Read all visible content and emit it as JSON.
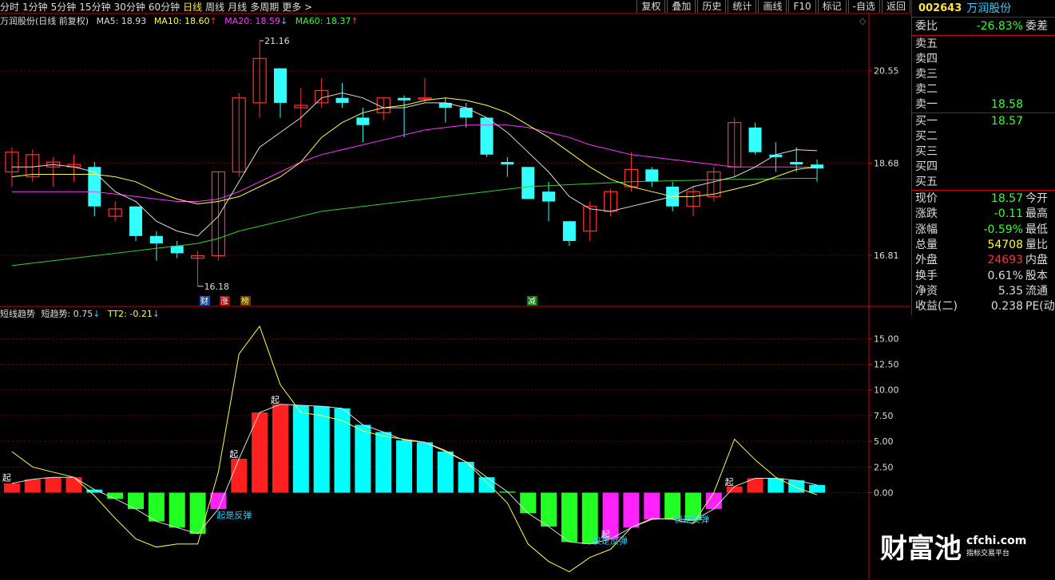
{
  "toolbar": {
    "timeframes": [
      "分时",
      "1分钟",
      "5分钟",
      "15分钟",
      "30分钟",
      "60分钟",
      "日线",
      "周线",
      "月线",
      "多周期",
      "更多 >"
    ],
    "active": "日线",
    "tools": [
      "复权",
      "叠加",
      "历史",
      "统计",
      "画线",
      "F10",
      "标记",
      "-自选",
      "返回"
    ]
  },
  "ma_header": {
    "title": "万润股份(日线 前复权)",
    "ma5": "MA5: 18.93",
    "ma5_color": "#dddddd",
    "ma10": "MA10: 18.60",
    "ma10_color": "#ffff44",
    "ma20": "MA20: 18.59",
    "ma20_color": "#ff33ff",
    "ma60": "MA60: 18.37",
    "ma60_color": "#33ff33"
  },
  "indicator_header": {
    "title": "短线趋势",
    "v1": "短趋势: 0.75",
    "v2": "TT2: -0.21"
  },
  "price_axis_labels": [
    "20.55",
    "18.68",
    "16.81"
  ],
  "ind_axis_labels": [
    "15.00",
    "12.50",
    "10.00",
    "7.50",
    "5.00",
    "2.50",
    "0.00"
  ],
  "annotations": {
    "high": "21.16",
    "low": "16.18",
    "tag1": "财",
    "tag2": "涨",
    "tag3": "榜",
    "tag4": "减",
    "qi": "起",
    "rebound1": "起是反弹",
    "rebound2": "仅是反弹",
    "rebound3": "仅是反弹"
  },
  "side_panel": {
    "code": "002643",
    "name": "万润股份",
    "weibi_label": "委比",
    "weibi_val": "-26.83%",
    "weicha_label": "委差",
    "asks": [
      {
        "label": "卖五",
        "val": ""
      },
      {
        "label": "卖四",
        "val": ""
      },
      {
        "label": "卖三",
        "val": ""
      },
      {
        "label": "卖二",
        "val": ""
      },
      {
        "label": "卖一",
        "val": "18.58"
      }
    ],
    "bids": [
      {
        "label": "买一",
        "val": "18.57"
      },
      {
        "label": "买二",
        "val": ""
      },
      {
        "label": "买三",
        "val": ""
      },
      {
        "label": "买四",
        "val": ""
      },
      {
        "label": "买五",
        "val": ""
      }
    ],
    "stats": [
      {
        "label": "现价",
        "val": "18.57",
        "label2": "今开",
        "color": "#33ff33"
      },
      {
        "label": "涨跌",
        "val": "-0.11",
        "label2": "最高",
        "color": "#33ff33"
      },
      {
        "label": "涨幅",
        "val": "-0.59%",
        "label2": "最低",
        "color": "#33ff33"
      },
      {
        "label": "总量",
        "val": "54708",
        "label2": "量比",
        "color": "#ffff33"
      },
      {
        "label": "外盘",
        "val": "24693",
        "label2": "内盘",
        "color": "#ff3333"
      },
      {
        "label": "换手",
        "val": "0.61%",
        "label2": "股本",
        "color": "#dddddd"
      },
      {
        "label": "净资",
        "val": "5.35",
        "label2": "流通",
        "color": "#dddddd"
      },
      {
        "label": "收益(二)",
        "val": "0.238",
        "label2": "PE(动)",
        "color": "#dddddd"
      }
    ]
  },
  "logo": {
    "big": "财富池",
    "site": "cfchi.com",
    "sub": "指标交易平台"
  },
  "chart_data": [
    {
      "type": "candlestick",
      "title": "万润股份(日线 前复权)",
      "ylim": [
        16.0,
        21.5
      ],
      "yticks": [
        20.55,
        18.68,
        16.81
      ],
      "candles": [
        {
          "o": 18.5,
          "c": 18.9,
          "h": 19.0,
          "l": 18.2
        },
        {
          "o": 18.4,
          "c": 18.85,
          "h": 18.95,
          "l": 18.3
        },
        {
          "o": 18.6,
          "c": 18.7,
          "h": 18.8,
          "l": 18.2
        },
        {
          "o": 18.6,
          "c": 18.65,
          "h": 18.85,
          "l": 18.3
        },
        {
          "o": 18.6,
          "c": 17.8,
          "h": 18.7,
          "l": 17.6
        },
        {
          "o": 17.6,
          "c": 17.75,
          "h": 17.9,
          "l": 17.5
        },
        {
          "o": 17.8,
          "c": 17.2,
          "h": 17.8,
          "l": 17.1
        },
        {
          "o": 17.2,
          "c": 17.05,
          "h": 17.3,
          "l": 16.7
        },
        {
          "o": 17.0,
          "c": 16.85,
          "h": 17.1,
          "l": 16.75
        },
        {
          "o": 16.75,
          "c": 16.8,
          "h": 16.9,
          "l": 16.18
        },
        {
          "o": 16.8,
          "c": 18.5,
          "h": 18.5,
          "l": 16.7
        },
        {
          "o": 18.5,
          "c": 20.0,
          "h": 20.1,
          "l": 18.4
        },
        {
          "o": 19.9,
          "c": 20.8,
          "h": 21.16,
          "l": 19.6
        },
        {
          "o": 20.6,
          "c": 19.9,
          "h": 20.6,
          "l": 19.6
        },
        {
          "o": 19.8,
          "c": 19.85,
          "h": 20.2,
          "l": 19.4
        },
        {
          "o": 19.9,
          "c": 20.15,
          "h": 20.4,
          "l": 19.8
        },
        {
          "o": 20.0,
          "c": 19.9,
          "h": 20.3,
          "l": 19.8
        },
        {
          "o": 19.6,
          "c": 19.45,
          "h": 19.8,
          "l": 19.1
        },
        {
          "o": 19.7,
          "c": 20.0,
          "h": 20.0,
          "l": 19.55
        },
        {
          "o": 20.0,
          "c": 19.95,
          "h": 20.05,
          "l": 19.2
        },
        {
          "o": 20.0,
          "c": 20.0,
          "h": 20.4,
          "l": 19.9
        },
        {
          "o": 19.9,
          "c": 19.8,
          "h": 20.0,
          "l": 19.5
        },
        {
          "o": 19.8,
          "c": 19.6,
          "h": 19.9,
          "l": 19.4
        },
        {
          "o": 19.6,
          "c": 18.85,
          "h": 19.6,
          "l": 18.8
        },
        {
          "o": 18.7,
          "c": 18.65,
          "h": 18.8,
          "l": 18.4
        },
        {
          "o": 18.6,
          "c": 17.95,
          "h": 18.6,
          "l": 17.95
        },
        {
          "o": 18.1,
          "c": 17.9,
          "h": 18.3,
          "l": 17.5
        },
        {
          "o": 17.5,
          "c": 17.1,
          "h": 17.5,
          "l": 17.0
        },
        {
          "o": 17.3,
          "c": 17.8,
          "h": 17.9,
          "l": 17.1
        },
        {
          "o": 17.7,
          "c": 18.1,
          "h": 18.15,
          "l": 17.6
        },
        {
          "o": 18.2,
          "c": 18.55,
          "h": 18.9,
          "l": 18.1
        },
        {
          "o": 18.55,
          "c": 18.3,
          "h": 18.6,
          "l": 18.2
        },
        {
          "o": 18.2,
          "c": 17.8,
          "h": 18.3,
          "l": 17.7
        },
        {
          "o": 17.8,
          "c": 18.1,
          "h": 18.2,
          "l": 17.6
        },
        {
          "o": 18.0,
          "c": 18.5,
          "h": 18.6,
          "l": 17.9
        },
        {
          "o": 18.6,
          "c": 19.5,
          "h": 19.6,
          "l": 18.4
        },
        {
          "o": 19.4,
          "c": 18.9,
          "h": 19.5,
          "l": 18.85
        },
        {
          "o": 18.85,
          "c": 18.8,
          "h": 19.1,
          "l": 18.5
        },
        {
          "o": 18.7,
          "c": 18.65,
          "h": 19.0,
          "l": 18.5
        },
        {
          "o": 18.65,
          "c": 18.57,
          "h": 18.75,
          "l": 18.3
        }
      ],
      "ma5": [
        18.6,
        18.6,
        18.65,
        18.6,
        18.5,
        18.1,
        17.9,
        17.5,
        17.3,
        17.2,
        17.6,
        18.3,
        19.0,
        19.3,
        19.6,
        20.0,
        20.1,
        20.0,
        19.8,
        19.8,
        19.9,
        19.9,
        19.8,
        19.6,
        19.3,
        18.9,
        18.5,
        18.0,
        17.75,
        17.7,
        17.8,
        17.9,
        18.0,
        18.2,
        18.3,
        18.4,
        18.6,
        18.85,
        18.95,
        18.93
      ],
      "ma10": [
        18.4,
        18.45,
        18.45,
        18.45,
        18.45,
        18.4,
        18.3,
        18.1,
        17.95,
        17.85,
        17.9,
        18.0,
        18.2,
        18.4,
        18.7,
        19.2,
        19.5,
        19.7,
        19.8,
        19.85,
        19.95,
        20.0,
        19.95,
        19.85,
        19.7,
        19.45,
        19.2,
        18.9,
        18.6,
        18.35,
        18.2,
        18.1,
        18.0,
        18.0,
        18.05,
        18.15,
        18.25,
        18.4,
        18.55,
        18.6
      ],
      "ma20": [
        18.1,
        18.1,
        18.1,
        18.1,
        18.1,
        18.05,
        18.0,
        17.95,
        17.9,
        17.9,
        17.95,
        18.1,
        18.3,
        18.5,
        18.7,
        18.85,
        18.95,
        19.05,
        19.15,
        19.25,
        19.35,
        19.4,
        19.45,
        19.45,
        19.45,
        19.4,
        19.3,
        19.2,
        19.05,
        18.95,
        18.85,
        18.8,
        18.75,
        18.7,
        18.65,
        18.6,
        18.6,
        18.6,
        18.6,
        18.59
      ],
      "ma60": [
        16.6,
        16.65,
        16.7,
        16.75,
        16.8,
        16.85,
        16.9,
        16.95,
        17.0,
        17.05,
        17.15,
        17.3,
        17.4,
        17.5,
        17.6,
        17.7,
        17.75,
        17.8,
        17.85,
        17.9,
        17.95,
        18.0,
        18.05,
        18.1,
        18.15,
        18.2,
        18.22,
        18.24,
        18.26,
        18.28,
        18.3,
        18.31,
        18.32,
        18.33,
        18.34,
        18.35,
        18.35,
        18.36,
        18.37,
        18.37
      ]
    },
    {
      "type": "bar",
      "title": "短线趋势",
      "ylim": [
        -8.5,
        16.5
      ],
      "yticks": [
        15.0,
        12.5,
        10.0,
        7.5,
        5.0,
        2.5,
        0.0
      ],
      "series": [
        {
          "name": "短趋势",
          "values": [
            0.9,
            1.3,
            1.5,
            1.5,
            0.3,
            -0.6,
            -1.6,
            -2.8,
            -3.4,
            -4.0,
            -1.6,
            3.3,
            7.8,
            8.6,
            8.5,
            8.4,
            8.2,
            6.6,
            5.9,
            5.1,
            4.9,
            4.0,
            3.0,
            1.5,
            0.1,
            -2.0,
            -3.3,
            -4.8,
            -5.0,
            -4.5,
            -3.4,
            -2.6,
            -2.5,
            -2.7,
            -1.6,
            0.6,
            1.4,
            1.4,
            1.2,
            0.75
          ],
          "colors": [
            "red",
            "red",
            "red",
            "red",
            "cyan",
            "green",
            "green",
            "green",
            "green",
            "green",
            "magenta",
            "red",
            "red",
            "red",
            "cyan",
            "cyan",
            "cyan",
            "cyan",
            "cyan",
            "cyan",
            "cyan",
            "cyan",
            "cyan",
            "cyan",
            "green",
            "green",
            "green",
            "green",
            "green",
            "magenta",
            "magenta",
            "magenta",
            "green",
            "green",
            "magenta",
            "red",
            "red",
            "cyan",
            "cyan",
            "cyan"
          ]
        },
        {
          "name": "TT2",
          "values": [
            4.0,
            2.5,
            2.0,
            1.5,
            -0.3,
            -2.5,
            -4.5,
            -5.3,
            -5.0,
            -5.0,
            2.0,
            13.5,
            16.2,
            10.5,
            7.8,
            7.5,
            7.0,
            6.0,
            5.5,
            5.2,
            4.9,
            4.1,
            3.0,
            1.0,
            -1.0,
            -5.0,
            -6.7,
            -7.7,
            -6.3,
            -5.5,
            -3.4,
            -2.5,
            -2.6,
            -3.0,
            0.0,
            5.2,
            3.2,
            1.5,
            0.5,
            -0.21
          ]
        }
      ]
    }
  ]
}
